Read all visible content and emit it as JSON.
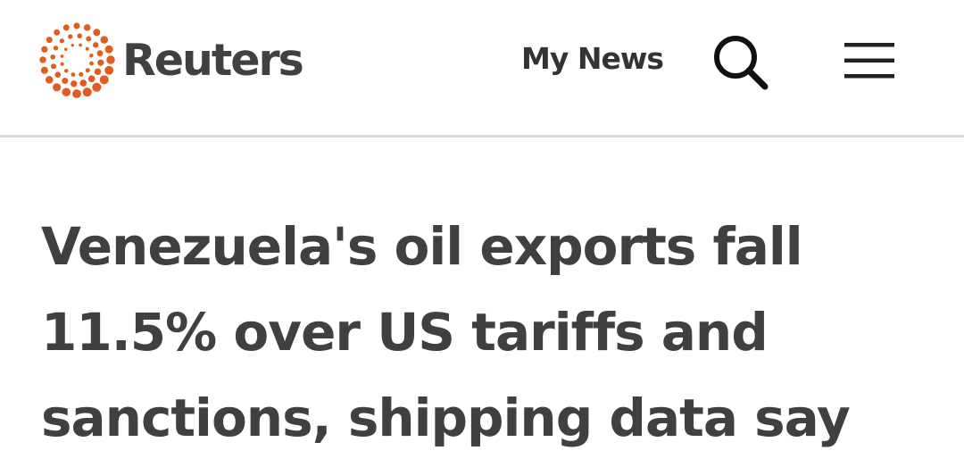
{
  "header": {
    "logo_text": "Reuters",
    "logo_icon": "reuters-dot-ring-logo",
    "my_news_label": "My News",
    "search_icon": "search-icon",
    "menu_icon": "hamburger-menu-icon"
  },
  "article": {
    "headline": "Venezuela's oil exports fall\n11.5% over US tariffs and\nsanctions, shipping data say"
  },
  "colors": {
    "brand_orange": "#e05c1f",
    "text_dark": "#404040",
    "divider": "#d9d9d9"
  }
}
